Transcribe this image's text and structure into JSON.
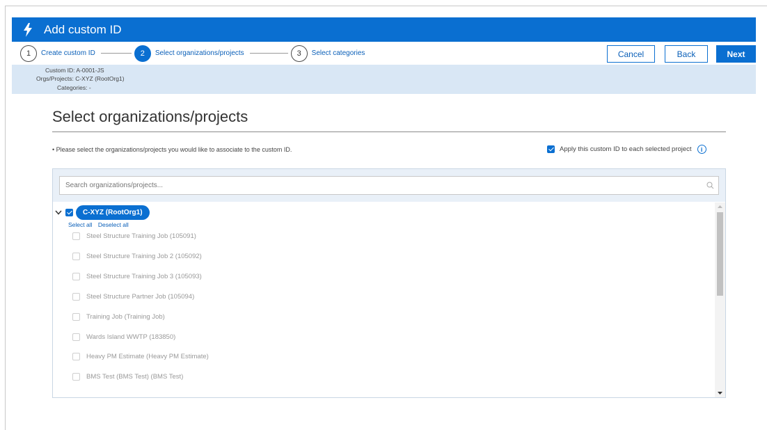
{
  "window": {
    "title": "Add custom ID"
  },
  "steps": [
    {
      "num": "1",
      "label": "Create custom ID"
    },
    {
      "num": "2",
      "label": "Select organizations/projects"
    },
    {
      "num": "3",
      "label": "Select categories"
    }
  ],
  "buttons": {
    "cancel": "Cancel",
    "back": "Back",
    "next": "Next"
  },
  "summary": {
    "custom_id": "Custom ID: A-0001-JS",
    "orgs": "Orgs/Projects: C-XYZ (RootOrg1)",
    "categories": "Categories: -"
  },
  "main": {
    "heading": "Select organizations/projects",
    "instruction": "• Please select the organizations/projects you would like to associate to the custom ID.",
    "apply_label": "Apply this custom ID to each selected project"
  },
  "search": {
    "placeholder": "Search organizations/projects..."
  },
  "tree": {
    "root_label": "C-XYZ (RootOrg1)",
    "select_all": "Select all",
    "deselect_all": "Deselect all",
    "items": [
      "Steel Structure Training Job (105091)",
      "Steel Structure Training Job 2 (105092)",
      "Steel Structure Training Job 3 (105093)",
      "Steel Structure Partner Job (105094)",
      "Training Job (Training Job)",
      "Wards Island WWTP (183850)",
      "Heavy PM Estimate (Heavy PM Estimate)",
      "BMS Test (BMS Test) (BMS Test)"
    ]
  },
  "colors": {
    "accent": "#0a6fd1",
    "summary_bg": "#d9e7f5"
  },
  "icons": [
    "bolt-icon",
    "chevron-down-icon",
    "search-icon",
    "info-icon",
    "checkbox-icon"
  ]
}
